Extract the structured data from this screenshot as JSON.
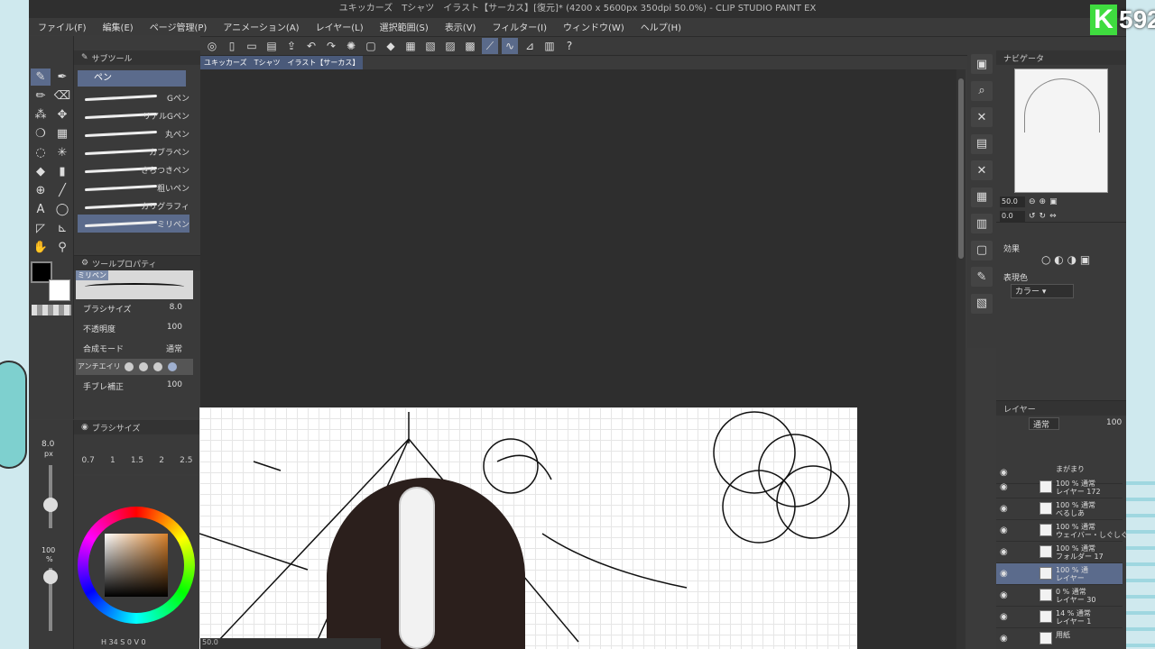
{
  "title": "ユキッカーズ　Tシャツ　イラスト【サーカス】[復元]* (4200 x 5600px 350dpi 50.0%)  - CLIP STUDIO PAINT EX",
  "menu": [
    "ファイル(F)",
    "編集(E)",
    "ページ管理(P)",
    "アニメーション(A)",
    "レイヤー(L)",
    "選択範囲(S)",
    "表示(V)",
    "フィルター(I)",
    "ウィンドウ(W)",
    "ヘルプ(H)"
  ],
  "doc_tab": "ユキッカーズ　Tシャツ　イラスト【サーカス】[復元]*",
  "subtool": {
    "header": "サブツール",
    "category": "ペン",
    "brushes": [
      "Gペン",
      "リアルGペン",
      "丸ペン",
      "カブラペン",
      "さらつきペン",
      "粗いペン",
      "カリグラフィ",
      "ミリペン"
    ]
  },
  "toolprop": {
    "header": "ツールプロパティ",
    "preview_label": "ミリペン",
    "brush_size_label": "ブラシサイズ",
    "brush_size": "8.0",
    "opacity_label": "不透明度",
    "opacity": "100",
    "blend_label": "合成モード",
    "blend": "通常",
    "aa_label": "アンチエイリ",
    "stabilize_label": "手ブレ補正",
    "stabilize": "100"
  },
  "brushsize": {
    "header": "ブラシサイズ",
    "current": "8.0",
    "unit": "px",
    "sizes": [
      "0.7",
      "1",
      "1.5",
      "2",
      "2.5"
    ]
  },
  "opacity_display": "100",
  "opacity_unit": "%",
  "color_main": "#d9822b",
  "status": {
    "zoom": "50.0",
    "coords": "H 34 S 0 V 0"
  },
  "navigator": {
    "header": "ナビゲータ",
    "zoom": "50.0",
    "angle": "0.0"
  },
  "effects": {
    "header": "効果",
    "color_label": "表現色",
    "color_value": "カラー"
  },
  "layers": {
    "header": "レイヤー",
    "blend": "通常",
    "opacity": "100",
    "rows": [
      {
        "l1": "まがまり",
        "l2": ""
      },
      {
        "l1": "100 % 通常",
        "l2": "レイヤー 172"
      },
      {
        "l1": "100 % 通常",
        "l2": "べるしあ"
      },
      {
        "l1": "100 % 通常",
        "l2": "ウェイバー・しぐしぐ"
      },
      {
        "l1": "100 % 通常",
        "l2": "フォルダー 17"
      },
      {
        "l1": "100 % 通",
        "l2": "レイヤー"
      },
      {
        "l1": "0 % 通常",
        "l2": "レイヤー 30"
      },
      {
        "l1": "14 % 通常",
        "l2": "レイヤー 1"
      },
      {
        "l1": "用紙",
        "l2": ""
      }
    ]
  },
  "logo": {
    "letter": "K",
    "number": "592"
  }
}
